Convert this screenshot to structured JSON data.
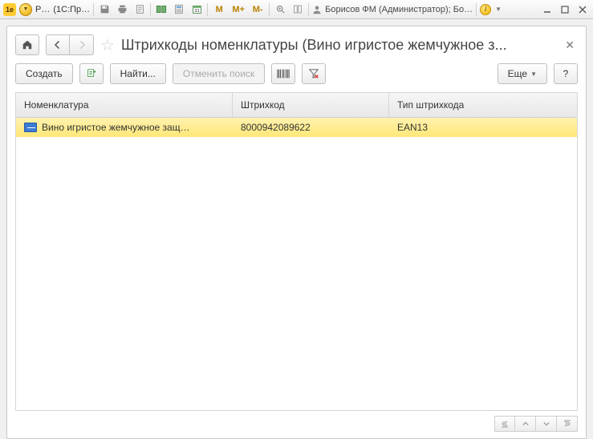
{
  "titlebar": {
    "app_abbrev": "Р…",
    "platform": "(1С:Пр…",
    "user_line": "Борисов ФМ (Администратор); Бо…",
    "m_labels": [
      "M",
      "M+",
      "M-"
    ]
  },
  "page": {
    "title": "Штрихкоды номенклатуры (Вино игристое жемчужное з..."
  },
  "toolbar": {
    "create": "Создать",
    "find": "Найти...",
    "cancel_search": "Отменить поиск",
    "more": "Еще",
    "help": "?"
  },
  "table": {
    "columns": {
      "nomenclature": "Номенклатура",
      "barcode": "Штрихкод",
      "barcode_type": "Тип штрихкода"
    },
    "rows": [
      {
        "nomenclature": "Вино игристое жемчужное защ…",
        "barcode": "8000942089622",
        "barcode_type": "EAN13",
        "selected": true
      }
    ]
  }
}
